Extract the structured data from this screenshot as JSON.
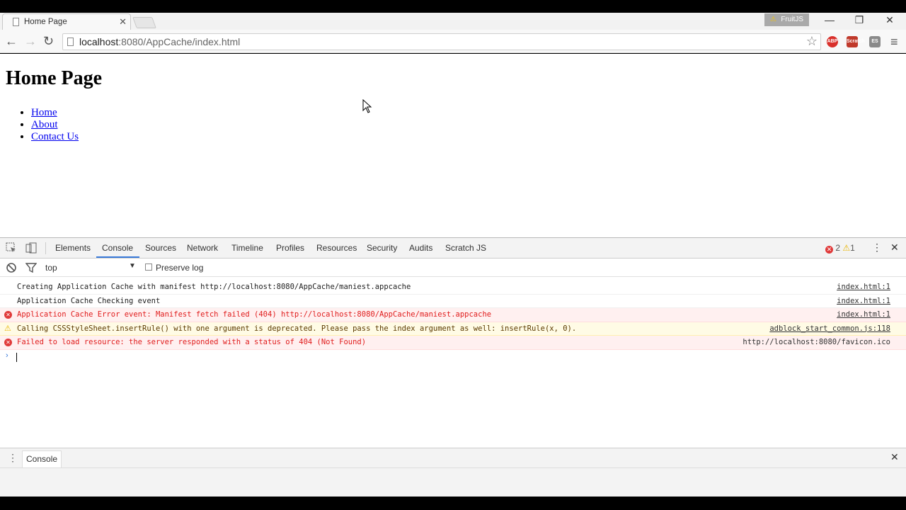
{
  "browser": {
    "tab_title": "Home Page",
    "tab_close": "✕",
    "extension_badge": "FruitJS",
    "window_controls": {
      "minimize": "—",
      "restore": "❐",
      "close": "✕"
    },
    "nav": {
      "back": "←",
      "forward": "→",
      "reload": "↻"
    },
    "url_host": "localhost",
    "url_path": ":8080/AppCache/index.html",
    "bookmark": "☆",
    "extensions": [
      "ABP",
      "Scratch",
      "ES"
    ],
    "menu": "≡"
  },
  "page": {
    "heading": "Home Page",
    "links": [
      "Home",
      "About",
      "Contact Us"
    ]
  },
  "devtools": {
    "tabs": [
      "Elements",
      "Console",
      "Sources",
      "Network",
      "Timeline",
      "Profiles",
      "Resources",
      "Security",
      "Audits",
      "Scratch JS"
    ],
    "active_tab": "Console",
    "error_count": "2",
    "warning_count": "1",
    "close": "✕",
    "more": "⋮",
    "filter": {
      "context": "top",
      "preserve_log": "Preserve log"
    },
    "messages": [
      {
        "level": "info",
        "text": "Creating Application Cache with manifest http://localhost:8080/AppCache/maniest.appcache",
        "source": "index.html:1"
      },
      {
        "level": "info",
        "text": "Application Cache Checking event",
        "source": "index.html:1"
      },
      {
        "level": "error",
        "text": "Application Cache Error event: Manifest fetch failed (404) http://localhost:8080/AppCache/maniest.appcache",
        "source": "index.html:1"
      },
      {
        "level": "warning",
        "text": "Calling CSSStyleSheet.insertRule() with one argument is deprecated. Please pass the index argument as well: insertRule(x, 0).",
        "source": "adblock_start_common.js:118"
      },
      {
        "level": "error",
        "text": "Failed to load resource: the server responded with a status of 404 (Not Found)",
        "source": "http://localhost:8080/favicon.ico"
      }
    ],
    "drawer": {
      "tab": "Console",
      "close": "✕",
      "more": "⋮"
    }
  }
}
